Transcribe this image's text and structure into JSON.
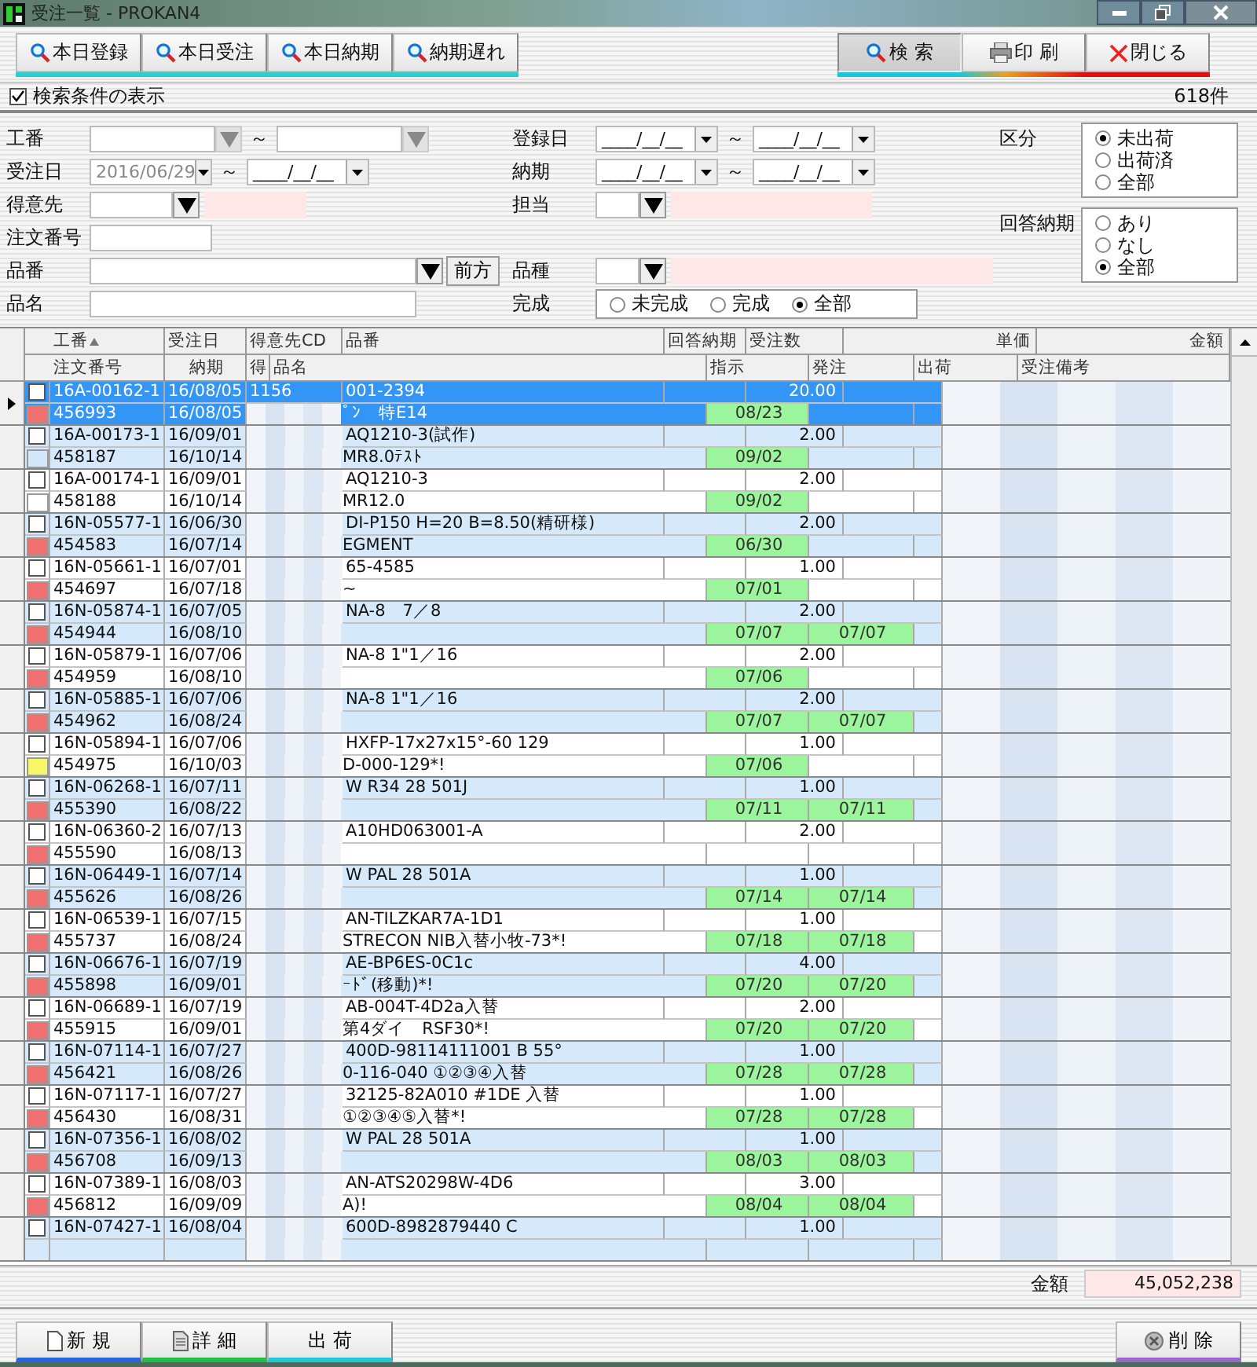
{
  "window": {
    "title": "受注一覧 - PROKAN4"
  },
  "quick_buttons": [
    {
      "label": "本日登録"
    },
    {
      "label": "本日受注"
    },
    {
      "label": "本日納期"
    },
    {
      "label": "納期遅れ"
    }
  ],
  "action_buttons": [
    {
      "label": "検 索",
      "kind": "search"
    },
    {
      "label": "印 刷",
      "kind": "print"
    },
    {
      "label": "閉じる",
      "kind": "close"
    }
  ],
  "show_conditions": {
    "label": "検索条件の表示",
    "checked": true
  },
  "count": "618件",
  "filters": {
    "koban": {
      "label": "工番",
      "sep": "～",
      "dropdown_disabled": true
    },
    "juchubi": {
      "label": "受注日",
      "from": "2016/06/29",
      "to": "____/__/__",
      "sep": "～"
    },
    "tokuisaki": {
      "label": "得意先"
    },
    "chumon": {
      "label": "注文番号"
    },
    "hinban": {
      "label": "品番",
      "button": "前方"
    },
    "hinmei": {
      "label": "品名"
    },
    "torokubi": {
      "label": "登録日",
      "from": "____/__/__",
      "to": "____/__/__",
      "sep": "～"
    },
    "noki": {
      "label": "納期",
      "from": "____/__/__",
      "to": "____/__/__",
      "sep": "～"
    },
    "tanto": {
      "label": "担当"
    },
    "hinshu": {
      "label": "品種"
    },
    "kansei": {
      "label": "完成",
      "options": [
        {
          "label": "未完成",
          "selected": false
        },
        {
          "label": "完成",
          "selected": false
        },
        {
          "label": "全部",
          "selected": true
        }
      ]
    },
    "kubun": {
      "label": "区分",
      "options": [
        {
          "label": "未出荷",
          "selected": true
        },
        {
          "label": "出荷済",
          "selected": false
        },
        {
          "label": "全部",
          "selected": false
        }
      ]
    },
    "kaito": {
      "label": "回答納期",
      "options": [
        {
          "label": "あり",
          "selected": false
        },
        {
          "label": "なし",
          "selected": false
        },
        {
          "label": "全部",
          "selected": true
        }
      ]
    }
  },
  "grid": {
    "columns_top": [
      {
        "label": "工番",
        "sorted": true
      },
      {
        "label": "受注日",
        "sorted": false
      },
      {
        "label": "得意先CD",
        "sorted": false
      },
      {
        "label": "品番",
        "sorted": false
      },
      {
        "label": "回答納期",
        "sorted": false
      },
      {
        "label": "受注数",
        "sorted": false
      },
      {
        "label": "単価",
        "sorted": false
      },
      {
        "label": "金額",
        "sorted": false
      }
    ],
    "columns_bottom": [
      "注文番号",
      "納期",
      "得",
      "品名",
      "指示",
      "発注",
      "出荷",
      "受注備考"
    ],
    "rows": [
      {
        "koban": "16A-00162-1",
        "date": "16/08/05",
        "cd": "1156",
        "hinban": "001-2394",
        "qty": "20.00",
        "chumon": "456993",
        "noki": "16/08/05",
        "hinmei": "ﾟﾝ　特E14",
        "shiji": "08/23",
        "color": "#f07070",
        "checked": false,
        "selected": true
      },
      {
        "koban": "16A-00173-1",
        "date": "16/09/01",
        "hinban": "AQ1210-3(試作)",
        "qty": "2.00",
        "chumon": "458187",
        "noki": "16/10/14",
        "hinmei": "MR8.0ﾃｽﾄ",
        "shiji": "09/02",
        "color": "#d4e7fb",
        "checked": false,
        "selected": false
      },
      {
        "koban": "16A-00174-1",
        "date": "16/09/01",
        "hinban": "AQ1210-3",
        "qty": "2.00",
        "chumon": "458188",
        "noki": "16/10/14",
        "hinmei": "MR12.0",
        "shiji": "09/02",
        "color": "#ffffff",
        "checked": false,
        "selected": false
      },
      {
        "koban": "16N-05577-1",
        "date": "16/06/30",
        "hinban": "DI-P150 H=20 B=8.50(精研様)",
        "qty": "2.00",
        "chumon": "454583",
        "noki": "16/07/14",
        "hinmei": "EGMENT",
        "shiji": "06/30",
        "color": "#f07070",
        "checked": false,
        "selected": false
      },
      {
        "koban": "16N-05661-1",
        "date": "16/07/01",
        "hinban": "65-4585",
        "qty": "1.00",
        "chumon": "454697",
        "noki": "16/07/18",
        "hinmei": "~",
        "shiji": "07/01",
        "color": "#f07070",
        "checked": false,
        "selected": false
      },
      {
        "koban": "16N-05874-1",
        "date": "16/07/05",
        "hinban": "NA-8　7／8",
        "qty": "2.00",
        "chumon": "454944",
        "noki": "16/08/10",
        "shiji": "07/07",
        "hachu": "07/07",
        "color": "#f07070",
        "checked": false,
        "selected": false
      },
      {
        "koban": "16N-05879-1",
        "date": "16/07/06",
        "hinban": "NA-8 1\"1／16",
        "qty": "2.00",
        "chumon": "454959",
        "noki": "16/08/10",
        "shiji": "07/06",
        "color": "#f07070",
        "checked": false,
        "selected": false
      },
      {
        "koban": "16N-05885-1",
        "date": "16/07/06",
        "hinban": "NA-8 1\"1／16",
        "qty": "2.00",
        "chumon": "454962",
        "noki": "16/08/24",
        "shiji": "07/07",
        "hachu": "07/07",
        "color": "#f07070",
        "checked": false,
        "selected": false
      },
      {
        "koban": "16N-05894-1",
        "date": "16/07/06",
        "hinban": "HXFP-17x27x15°-60 129",
        "qty": "1.00",
        "chumon": "454975",
        "noki": "16/10/03",
        "hinmei": "D-000-129*!",
        "shiji": "07/06",
        "color": "#f7f76a",
        "checked": false,
        "selected": false
      },
      {
        "koban": "16N-06268-1",
        "date": "16/07/11",
        "hinban": "W R34 28 501J",
        "qty": "1.00",
        "chumon": "455390",
        "noki": "16/08/22",
        "shiji": "07/11",
        "hachu": "07/11",
        "color": "#f07070",
        "checked": false,
        "selected": false
      },
      {
        "koban": "16N-06360-2",
        "date": "16/07/13",
        "hinban": "A10HD063001-A",
        "qty": "2.00",
        "chumon": "455590",
        "noki": "16/08/13",
        "color": "#f07070",
        "checked": false,
        "selected": false
      },
      {
        "koban": "16N-06449-1",
        "date": "16/07/14",
        "hinban": "W PAL 28 501A",
        "qty": "1.00",
        "chumon": "455626",
        "noki": "16/08/26",
        "shiji": "07/14",
        "hachu": "07/14",
        "color": "#f07070",
        "checked": false,
        "selected": false
      },
      {
        "koban": "16N-06539-1",
        "date": "16/07/15",
        "hinban": "AN-TILZKAR7A-1D1",
        "qty": "1.00",
        "chumon": "455737",
        "noki": "16/08/24",
        "hinmei": "STRECON NIB入替小牧-73*!",
        "shiji": "07/18",
        "hachu": "07/18",
        "color": "#f07070",
        "checked": false,
        "selected": false
      },
      {
        "koban": "16N-06676-1",
        "date": "16/07/19",
        "hinban": "AE-BP6ES-0C1c",
        "qty": "4.00",
        "chumon": "455898",
        "noki": "16/09/01",
        "hinmei": "ｰﾄﾞ(移動)*!",
        "shiji": "07/20",
        "hachu": "07/20",
        "color": "#f07070",
        "checked": false,
        "selected": false
      },
      {
        "koban": "16N-06689-1",
        "date": "16/07/19",
        "hinban": "AB-004T-4D2a入替",
        "qty": "2.00",
        "chumon": "455915",
        "noki": "16/09/01",
        "hinmei": "第4ダイ　RSF30*!",
        "shiji": "07/20",
        "hachu": "07/20",
        "color": "#f07070",
        "checked": false,
        "selected": false
      },
      {
        "koban": "16N-07114-1",
        "date": "16/07/27",
        "hinban": "400D-98114111001 B 55°",
        "qty": "1.00",
        "chumon": "456421",
        "noki": "16/08/26",
        "hinmei": "0-116-040 ①②③④入替",
        "shiji": "07/28",
        "hachu": "07/28",
        "color": "#f07070",
        "checked": false,
        "selected": false
      },
      {
        "koban": "16N-07117-1",
        "date": "16/07/27",
        "hinban": "32125-82A010 #1DE 入替",
        "qty": "1.00",
        "chumon": "456430",
        "noki": "16/08/31",
        "hinmei": "①②③④⑤入替*!",
        "shiji": "07/28",
        "hachu": "07/28",
        "color": "#f07070",
        "checked": false,
        "selected": false
      },
      {
        "koban": "16N-07356-1",
        "date": "16/08/02",
        "hinban": "W PAL 28 501A",
        "qty": "1.00",
        "chumon": "456708",
        "noki": "16/09/13",
        "shiji": "08/03",
        "hachu": "08/03",
        "color": "#f07070",
        "checked": false,
        "selected": false
      },
      {
        "koban": "16N-07389-1",
        "date": "16/08/03",
        "hinban": "AN-ATS20298W-4D6",
        "qty": "3.00",
        "chumon": "456812",
        "noki": "16/09/09",
        "hinmei": "A)!",
        "shiji": "08/04",
        "hachu": "08/04",
        "color": "#f07070",
        "checked": false,
        "selected": false
      },
      {
        "koban": "16N-07427-1",
        "date": "16/08/04",
        "hinban": "600D-8982879440 C",
        "qty": "1.00",
        "checked": false,
        "selected": false
      }
    ]
  },
  "total": {
    "label": "金額",
    "value": "45,052,238"
  },
  "bottom_buttons": [
    {
      "label": "新 規",
      "kind": "new"
    },
    {
      "label": "詳 細",
      "kind": "detail"
    },
    {
      "label": "出 荷",
      "kind": "ship"
    }
  ],
  "delete_button": {
    "label": "削 除",
    "kind": "delete"
  }
}
